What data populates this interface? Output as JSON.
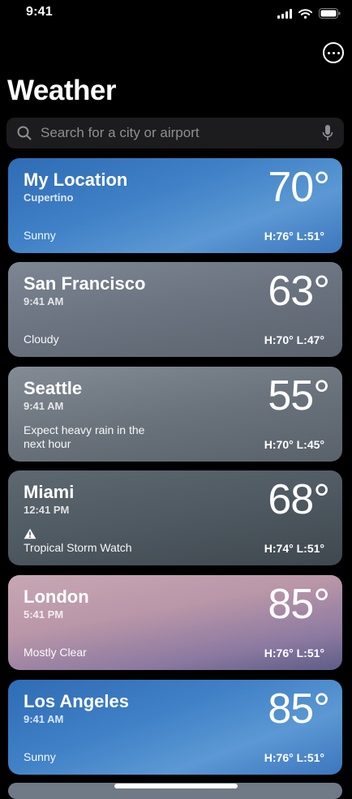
{
  "status": {
    "time": "9:41"
  },
  "header": {
    "title": "Weather",
    "more_icon": "ellipsis-circle-icon"
  },
  "search": {
    "placeholder": "Search for a city or airport",
    "value": "",
    "icon": "search-icon",
    "mic_icon": "microphone-icon"
  },
  "cards": [
    {
      "city": "My Location",
      "sub": "Cupertino",
      "temp": "70°",
      "condition": "Sunny",
      "hl": "H:76°  L:51°"
    },
    {
      "city": "San Francisco",
      "sub": "9:41 AM",
      "temp": "63°",
      "condition": "Cloudy",
      "hl": "H:70°  L:47°"
    },
    {
      "city": "Seattle",
      "sub": "9:41 AM",
      "temp": "55°",
      "condition": "Expect heavy rain in the next hour",
      "hl": "H:70°  L:45°"
    },
    {
      "city": "Miami",
      "sub": "12:41 PM",
      "temp": "68°",
      "condition": "Tropical Storm Watch",
      "hl": "H:74°  L:51°",
      "alert_icon": "warning-triangle-icon"
    },
    {
      "city": "London",
      "sub": "5:41 PM",
      "temp": "85°",
      "condition": "Mostly Clear",
      "hl": "H:76°  L:51°"
    },
    {
      "city": "Los Angeles",
      "sub": "9:41 AM",
      "temp": "85°",
      "condition": "Sunny",
      "hl": "H:76°  L:51°"
    }
  ]
}
